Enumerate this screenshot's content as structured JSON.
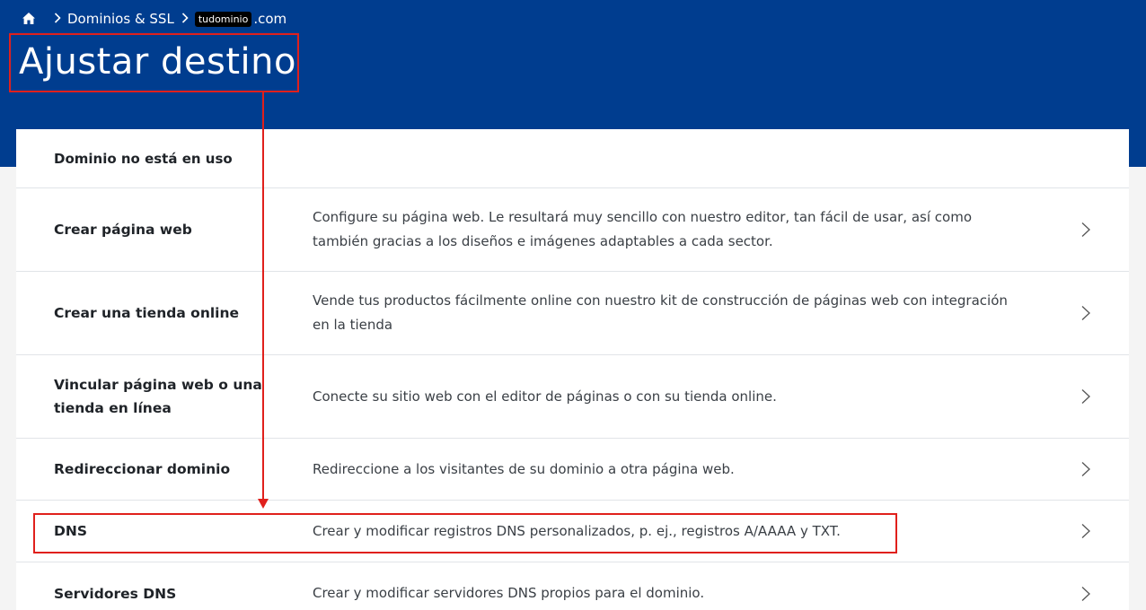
{
  "breadcrumb": {
    "home_icon": "home-icon",
    "items": [
      "Dominios & SSL",
      "tudominio",
      ".com"
    ]
  },
  "page": {
    "title": "Ajustar destino"
  },
  "section": {
    "title": "Dominio no está en uso"
  },
  "options": [
    {
      "title": "Crear página web",
      "description": "Configure su página web. Le resultará muy sencillo con nuestro editor, tan fácil de usar, así como también gracias a los diseños e imágenes adaptables a cada sector."
    },
    {
      "title": "Crear una tienda online",
      "description": "Vende tus productos fácilmente online con nuestro kit de construcción de páginas web con integración en la tienda"
    },
    {
      "title": "Vincular página web o una tienda en línea",
      "description": "Conecte su sitio web con el editor de páginas o con su tienda online."
    },
    {
      "title": "Redireccionar dominio",
      "description": "Redireccione a los visitantes de su dominio a otra página web."
    },
    {
      "title": "DNS",
      "description": "Crear y modificar registros DNS personalizados, p. ej., registros A/AAAA y TXT."
    },
    {
      "title": "Servidores DNS",
      "description": "Crear y modificar servidores DNS propios para el dominio."
    }
  ],
  "colors": {
    "header": "#003d8f",
    "annotation": "#e0201c"
  }
}
